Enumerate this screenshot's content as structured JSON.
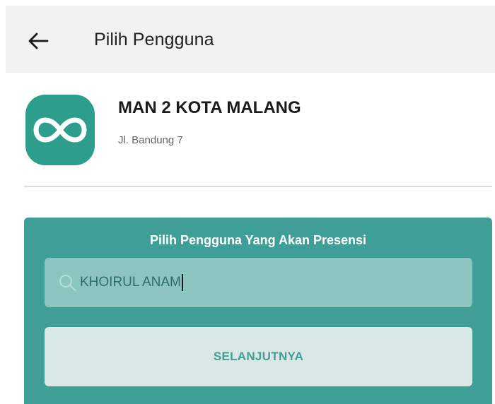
{
  "appbar": {
    "title": "Pilih Pengguna",
    "back_icon": "arrow-left-icon"
  },
  "school": {
    "logo_icon": "infinity-icon",
    "name": "MAN 2 KOTA MALANG",
    "address": "Jl. Bandung 7"
  },
  "card": {
    "title": "Pilih Pengguna Yang Akan Presensi",
    "search": {
      "icon": "search-icon",
      "value": "KHOIRUL ANAM"
    },
    "next_label": "SELANJUTNYA"
  },
  "colors": {
    "accent": "#3f9e95",
    "logo": "#2e9e8c",
    "appbar": "#f2f2f2",
    "search_field": "#8cc5bf",
    "button_bg": "#d9e7e5"
  }
}
